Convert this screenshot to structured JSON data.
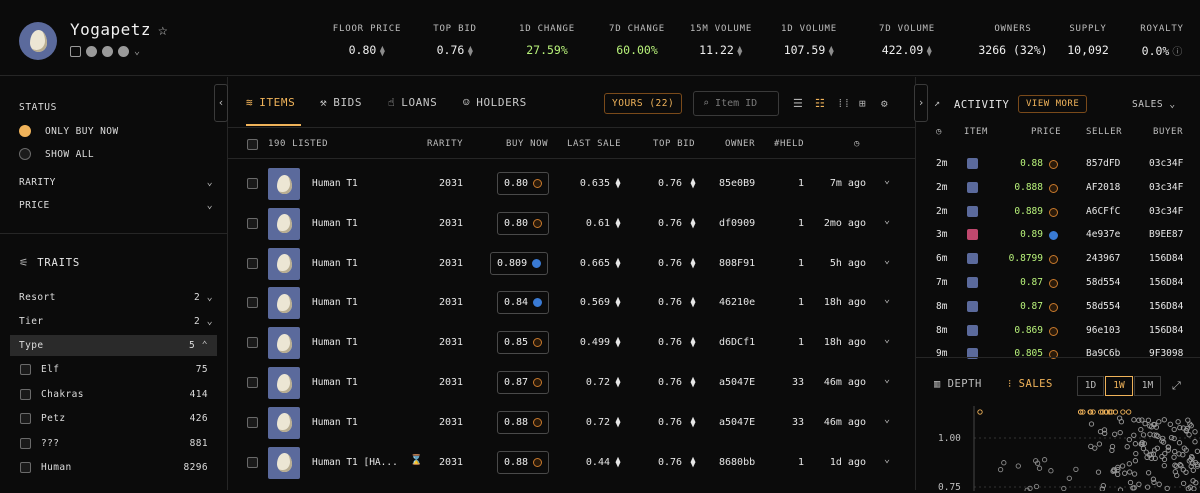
{
  "collection": {
    "name": "Yogapetz"
  },
  "stats": [
    {
      "label": "FLOOR PRICE",
      "value": "0.80",
      "eth": true
    },
    {
      "label": "TOP BID",
      "value": "0.76",
      "eth": true
    },
    {
      "label": "1D CHANGE",
      "value": "27.59%",
      "positive": true
    },
    {
      "label": "7D CHANGE",
      "value": "60.00%",
      "positive": true
    },
    {
      "label": "15M VOLUME",
      "value": "11.22",
      "eth": true
    },
    {
      "label": "1D VOLUME",
      "value": "107.59",
      "eth": true
    },
    {
      "label": "7D VOLUME",
      "value": "422.09",
      "eth": true
    },
    {
      "label": "OWNERS",
      "value": "3266 (32%)"
    },
    {
      "label": "SUPPLY",
      "value": "10,092"
    },
    {
      "label": "ROYALTY",
      "value": "0.0%"
    }
  ],
  "sidebar": {
    "status_label": "STATUS",
    "only_buy_now": "ONLY BUY NOW",
    "show_all": "SHOW ALL",
    "rarity": "RARITY",
    "price": "PRICE",
    "traits_label": "TRAITS",
    "traits": [
      {
        "name": "Resort",
        "count": "2"
      },
      {
        "name": "Tier",
        "count": "2"
      },
      {
        "name": "Type",
        "count": "5"
      }
    ],
    "type_options": [
      {
        "name": "Elf",
        "count": "75"
      },
      {
        "name": "Chakras",
        "count": "414"
      },
      {
        "name": "Petz",
        "count": "426"
      },
      {
        "name": "???",
        "count": "881"
      },
      {
        "name": "Human",
        "count": "8296"
      }
    ]
  },
  "tabs": {
    "items": "ITEMS",
    "bids": "BIDS",
    "loans": "LOANS",
    "holders": "HOLDERS",
    "yours": "YOURS (22)",
    "search_placeholder": "Item ID"
  },
  "table": {
    "headers": {
      "listed": "190 LISTED",
      "rarity": "RARITY",
      "buy_now": "BUY NOW",
      "last_sale": "LAST SALE",
      "top_bid": "TOP BID",
      "owner": "OWNER",
      "held": "#HELD"
    },
    "rows": [
      {
        "name": "Human T1",
        "rarity": "2031",
        "buy_now": "0.80",
        "mk": "orange",
        "last_sale": "0.635",
        "top_bid": "0.76",
        "owner": "85e0B9",
        "held": "1",
        "time": "7m ago"
      },
      {
        "name": "Human T1",
        "rarity": "2031",
        "buy_now": "0.80",
        "mk": "orange",
        "last_sale": "0.61",
        "top_bid": "0.76",
        "owner": "df0909",
        "held": "1",
        "time": "2mo ago"
      },
      {
        "name": "Human T1",
        "rarity": "2031",
        "buy_now": "0.809",
        "mk": "blue",
        "last_sale": "0.665",
        "top_bid": "0.76",
        "owner": "808F91",
        "held": "1",
        "time": "5h ago"
      },
      {
        "name": "Human T1",
        "rarity": "2031",
        "buy_now": "0.84",
        "mk": "blue",
        "last_sale": "0.569",
        "top_bid": "0.76",
        "owner": "46210e",
        "held": "1",
        "time": "18h ago"
      },
      {
        "name": "Human T1",
        "rarity": "2031",
        "buy_now": "0.85",
        "mk": "orange",
        "last_sale": "0.499",
        "top_bid": "0.76",
        "owner": "d6DCf1",
        "held": "1",
        "time": "18h ago"
      },
      {
        "name": "Human T1",
        "rarity": "2031",
        "buy_now": "0.87",
        "mk": "orange",
        "last_sale": "0.72",
        "top_bid": "0.76",
        "owner": "a5047E",
        "held": "33",
        "time": "46m ago"
      },
      {
        "name": "Human T1",
        "rarity": "2031",
        "buy_now": "0.88",
        "mk": "orange",
        "last_sale": "0.72",
        "top_bid": "0.76",
        "owner": "a5047E",
        "held": "33",
        "time": "46m ago"
      },
      {
        "name": "Human T1 [HA...",
        "rarity": "2031",
        "buy_now": "0.88",
        "mk": "orange",
        "last_sale": "0.44",
        "top_bid": "0.76",
        "owner": "8680bb",
        "held": "1",
        "time": "1d ago"
      }
    ]
  },
  "activity": {
    "title": "ACTIVITY",
    "view_more": "VIEW MORE",
    "filter": "SALES",
    "headers": {
      "item": "ITEM",
      "price": "PRICE",
      "seller": "SELLER",
      "buyer": "BUYER"
    },
    "rows": [
      {
        "time": "2m",
        "price": "0.88",
        "mk": "orange",
        "seller": "857dFD",
        "buyer": "03c34F"
      },
      {
        "time": "2m",
        "price": "0.888",
        "mk": "orange",
        "seller": "AF2018",
        "buyer": "03c34F"
      },
      {
        "time": "2m",
        "price": "0.889",
        "mk": "orange",
        "seller": "A6CFfC",
        "buyer": "03c34F"
      },
      {
        "time": "3m",
        "price": "0.89",
        "mk": "blue",
        "seller": "4e937e",
        "buyer": "B9EE87"
      },
      {
        "time": "6m",
        "price": "0.8799",
        "mk": "orange",
        "seller": "243967",
        "buyer": "156D84"
      },
      {
        "time": "7m",
        "price": "0.87",
        "mk": "orange",
        "seller": "58d554",
        "buyer": "156D84"
      },
      {
        "time": "8m",
        "price": "0.87",
        "mk": "orange",
        "seller": "58d554",
        "buyer": "156D84"
      },
      {
        "time": "8m",
        "price": "0.869",
        "mk": "orange",
        "seller": "96e103",
        "buyer": "156D84"
      },
      {
        "time": "9m",
        "price": "0.805",
        "mk": "orange",
        "seller": "Ba9C6b",
        "buyer": "9F3098"
      }
    ]
  },
  "chart": {
    "depth": "DEPTH",
    "sales": "SALES",
    "ranges": [
      "1D",
      "1W",
      "1M"
    ],
    "active_range": "1W",
    "y_ticks": [
      "1.00",
      "0.75"
    ]
  },
  "colors": {
    "accent": "#f0b35a",
    "positive": "#b8f27a",
    "avatar_bg": "#5b6a9c"
  }
}
